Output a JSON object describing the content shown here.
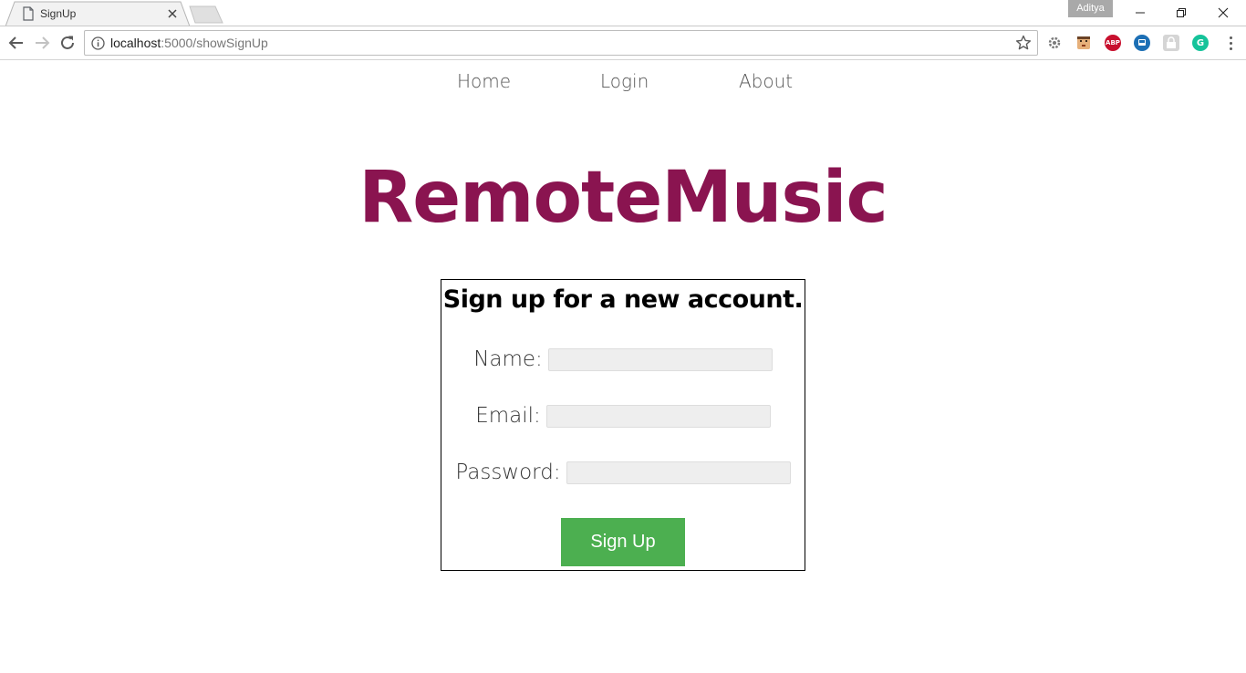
{
  "browser": {
    "tab_title": "SignUp",
    "profile_name": "Aditya",
    "url_host": "localhost",
    "url_path": ":5000/showSignUp",
    "extensions": [
      {
        "name": "settings-extension-icon",
        "label": "",
        "color": "#7a7a7a"
      },
      {
        "name": "emoji-extension-icon",
        "label": "",
        "color": "#d9a066"
      },
      {
        "name": "adblock-plus-icon",
        "label": "ABP",
        "color": "#c8102e"
      },
      {
        "name": "bus-extension-icon",
        "label": "",
        "color": "#1c6fb5"
      },
      {
        "name": "lock-extension-icon",
        "label": "",
        "color": "#d5d5d5"
      },
      {
        "name": "grammarly-icon",
        "label": "G",
        "color": "#15c39a"
      }
    ]
  },
  "nav": {
    "home": "Home",
    "login": "Login",
    "about": "About"
  },
  "brand": {
    "title": "RemoteMusic",
    "color": "#8a1450"
  },
  "signup": {
    "heading": "Sign up for a new account.",
    "name_label": "Name:",
    "name_value": "",
    "email_label": "Email:",
    "email_value": "",
    "password_label": "Password:",
    "password_value": "",
    "button_label": "Sign Up",
    "button_color": "#4caf50"
  }
}
